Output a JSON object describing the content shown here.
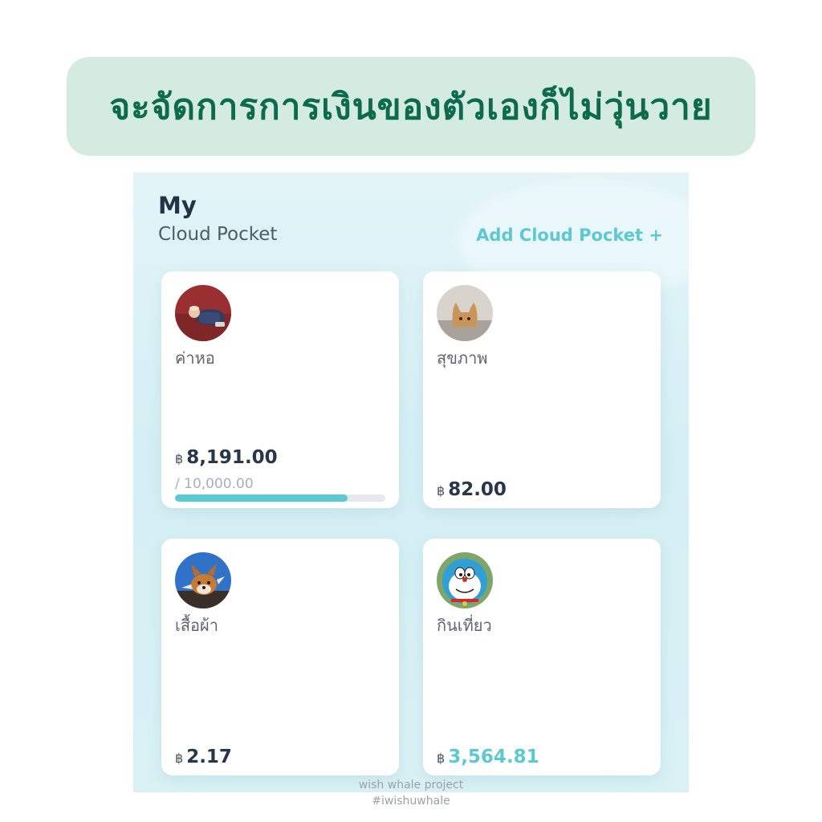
{
  "banner": {
    "title": "จะจัดการการเงินของตัวเองก็ไม่วุ่นวาย"
  },
  "header": {
    "title": "My",
    "subtitle": "Cloud Pocket",
    "add_button": "Add Cloud Pocket +"
  },
  "currency_symbol": "฿",
  "pockets": [
    {
      "name": "ค่าหอ",
      "amount": "8,191.00",
      "goal": "/ 10,000.00",
      "progress": 0.8191
    },
    {
      "name": "สุขภาพ",
      "amount": "82.00"
    },
    {
      "name": "เสื้อผ้า",
      "amount": "2.17"
    },
    {
      "name": "กินเที่ยว",
      "amount": "3,564.81"
    }
  ],
  "colors": {
    "accent": "#5cc9d2",
    "banner_bg": "#d3ebe1",
    "banner_text": "#0d6a4d",
    "text_dark": "#29364a"
  },
  "watermark": {
    "line1": "wish whale project",
    "line2": "#iwishuwhale"
  }
}
